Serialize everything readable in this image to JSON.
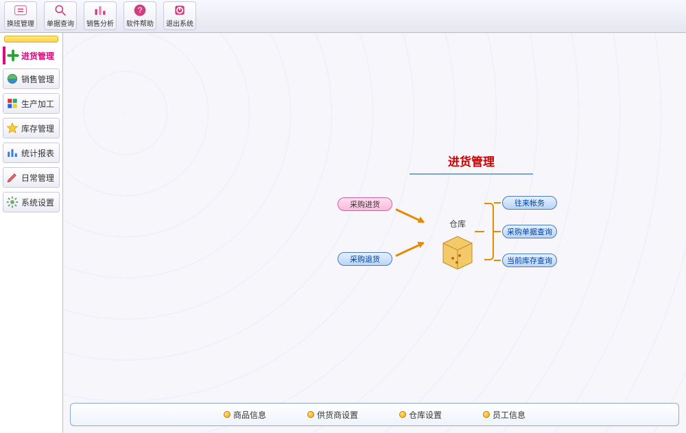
{
  "toolbar": [
    {
      "label": "换班管理",
      "icon": "swap"
    },
    {
      "label": "单据查询",
      "icon": "search"
    },
    {
      "label": "销售分析",
      "icon": "bars"
    },
    {
      "label": "软件帮助",
      "icon": "help"
    },
    {
      "label": "退出系统",
      "icon": "power"
    }
  ],
  "sidebar": {
    "active": {
      "label": "进货管理",
      "icon": "plus"
    },
    "items": [
      {
        "label": "销售管理",
        "icon": "globe"
      },
      {
        "label": "生产加工",
        "icon": "blocks"
      },
      {
        "label": "库存管理",
        "icon": "star"
      },
      {
        "label": "统计报表",
        "icon": "chart"
      },
      {
        "label": "日常管理",
        "icon": "pencil"
      },
      {
        "label": "系统设置",
        "icon": "gear"
      }
    ]
  },
  "diagram": {
    "title": "进货管理",
    "warehouse_label": "仓库",
    "left_buttons": [
      {
        "label": "采购进货",
        "style": "pink"
      },
      {
        "label": "采购退货",
        "style": "blue"
      }
    ],
    "right_buttons": [
      {
        "label": "往来帐务"
      },
      {
        "label": "采购单据查询"
      },
      {
        "label": "当前库存查询"
      }
    ]
  },
  "bottom_links": [
    {
      "label": "商品信息"
    },
    {
      "label": "供货商设置"
    },
    {
      "label": "仓库设置"
    },
    {
      "label": "员工信息"
    }
  ]
}
